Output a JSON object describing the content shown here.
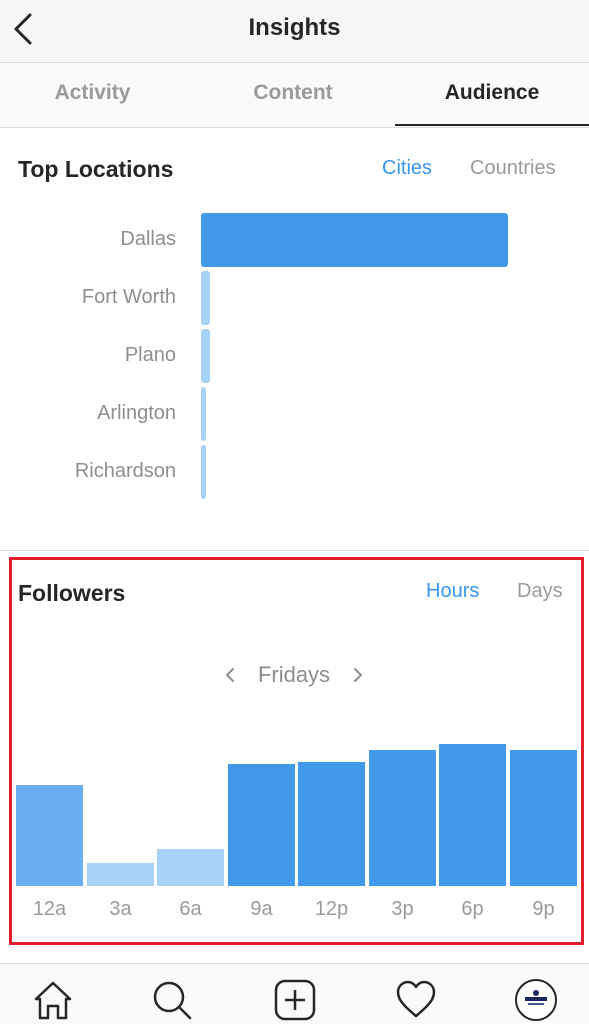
{
  "header": {
    "title": "Insights",
    "back_icon": "chevron-left-icon"
  },
  "tabs": [
    {
      "label": "Activity",
      "active": false
    },
    {
      "label": "Content",
      "active": false
    },
    {
      "label": "Audience",
      "active": true
    }
  ],
  "top_locations": {
    "title": "Top Locations",
    "toggle_cities": "Cities",
    "toggle_countries": "Countries",
    "selected": "Cities",
    "cities": [
      {
        "name": "Dallas",
        "share": 1.0
      },
      {
        "name": "Fort Worth",
        "share": 0.03
      },
      {
        "name": "Plano",
        "share": 0.03
      },
      {
        "name": "Arlington",
        "share": 0.015
      },
      {
        "name": "Richardson",
        "share": 0.015
      }
    ]
  },
  "followers": {
    "title": "Followers",
    "toggle_hours": "Hours",
    "toggle_days": "Days",
    "selected": "Hours",
    "day": "Fridays",
    "prev_icon": "chevron-left-icon",
    "next_icon": "chevron-right-icon"
  },
  "chart_data": {
    "type": "bar",
    "categories": [
      "12a",
      "3a",
      "6a",
      "9a",
      "12p",
      "3p",
      "6p",
      "9p"
    ],
    "values": [
      0.71,
      0.16,
      0.26,
      0.86,
      0.87,
      0.96,
      1.0,
      0.96
    ],
    "ylim": [
      0,
      1
    ],
    "colors": [
      "#6aaff2",
      "#a9d2f8",
      "#a9d2f8",
      "#4199ea",
      "#4199ea",
      "#4199ea",
      "#4199ea",
      "#4199ea"
    ]
  },
  "colors": {
    "accent": "#3897f0",
    "bar_primary": "#4199ea",
    "bar_light": "#a9d2f8",
    "highlight": "#e01e2d"
  },
  "bottom_nav": [
    {
      "name": "home-icon"
    },
    {
      "name": "search-icon"
    },
    {
      "name": "add-post-icon"
    },
    {
      "name": "heart-icon"
    },
    {
      "name": "profile-avatar"
    }
  ]
}
